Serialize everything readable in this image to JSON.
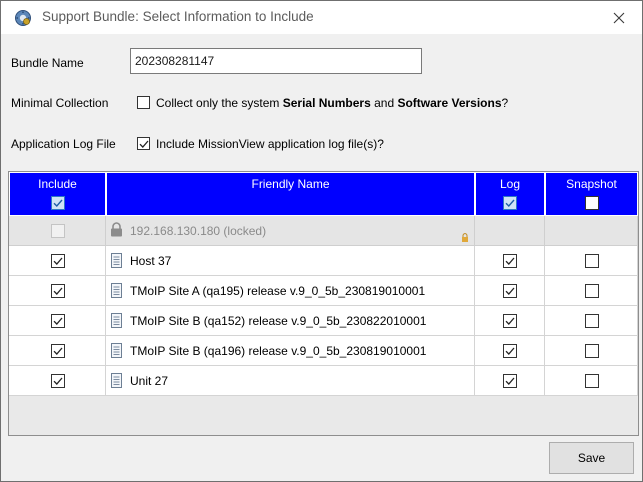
{
  "window": {
    "title": "Support Bundle: Select Information to Include",
    "close_icon": "close-icon",
    "app_icon": "support-bundle-icon"
  },
  "form": {
    "bundle_name_label": "Bundle Name",
    "bundle_name_value": "202308281147",
    "minimal_collection_label": "Minimal Collection",
    "minimal_collection_text_1": "Collect only the system ",
    "minimal_collection_bold_1": "Serial Numbers",
    "minimal_collection_text_2": " and ",
    "minimal_collection_bold_2": "Software Versions",
    "minimal_collection_text_3": "?",
    "minimal_collection_checked": false,
    "app_log_label": "Application Log File",
    "app_log_text": "Include MissionView application log file(s)?",
    "app_log_checked": true
  },
  "grid": {
    "header_color": "#0000ff",
    "columns": {
      "include": "Include",
      "friendly_name": "Friendly Name",
      "log": "Log",
      "snapshot": "Snapshot"
    },
    "header_checks": {
      "include": true,
      "log": true,
      "snapshot": false
    },
    "rows": [
      {
        "name": "192.168.130.180 (locked)",
        "icon": "lock-icon",
        "locked": true,
        "include": false,
        "log": null,
        "snapshot": null
      },
      {
        "name": "Host 37",
        "icon": "document-icon",
        "locked": false,
        "include": true,
        "log": true,
        "snapshot": false
      },
      {
        "name": "TMoIP Site A (qa195) release v.9_0_5b_230819010001",
        "icon": "document-icon",
        "locked": false,
        "include": true,
        "log": true,
        "snapshot": false
      },
      {
        "name": "TMoIP Site B (qa152) release v.9_0_5b_230822010001",
        "icon": "document-icon",
        "locked": false,
        "include": true,
        "log": true,
        "snapshot": false
      },
      {
        "name": "TMoIP Site B (qa196) release v.9_0_5b_230819010001",
        "icon": "document-icon",
        "locked": false,
        "include": true,
        "log": true,
        "snapshot": false
      },
      {
        "name": "Unit 27",
        "icon": "document-icon",
        "locked": false,
        "include": true,
        "log": true,
        "snapshot": false
      }
    ]
  },
  "footer": {
    "save_label": "Save"
  }
}
